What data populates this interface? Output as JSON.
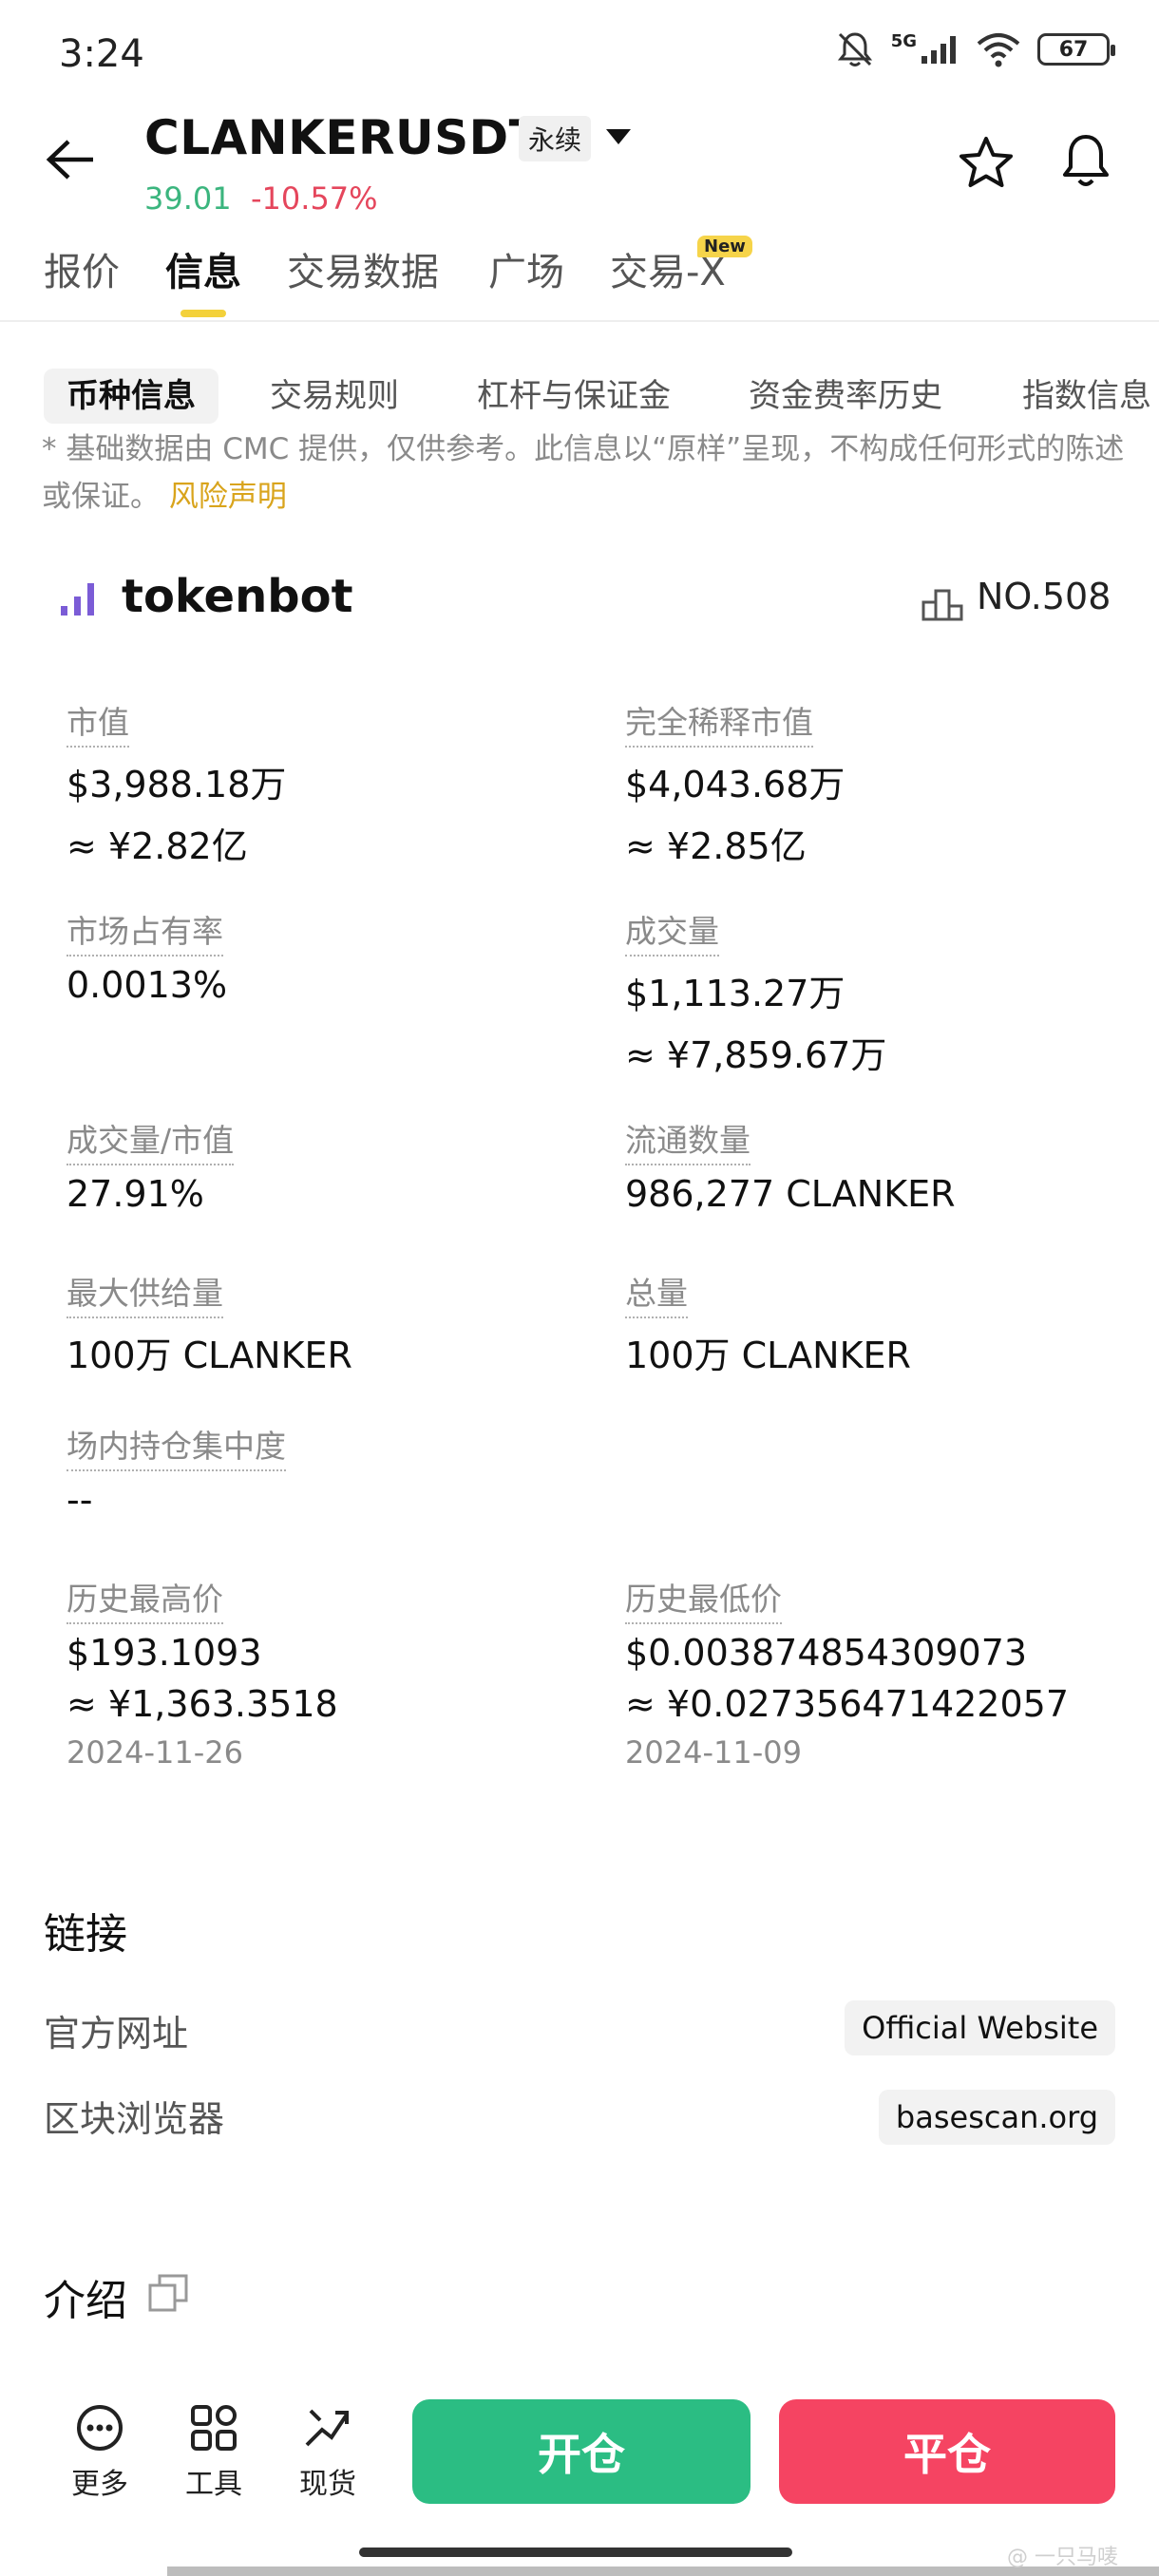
{
  "status": {
    "time": "3:24",
    "network": "5G",
    "battery": "67"
  },
  "header": {
    "symbol": "CLANKERUSDT",
    "contract_type": "永续",
    "price": "39.01",
    "change": "-10.57%"
  },
  "tabs": [
    {
      "label": "报价"
    },
    {
      "label": "信息"
    },
    {
      "label": "交易数据"
    },
    {
      "label": "广场"
    },
    {
      "label": "交易-X"
    }
  ],
  "new_badge": "New",
  "sub_tabs": [
    {
      "label": "币种信息"
    },
    {
      "label": "交易规则"
    },
    {
      "label": "杠杆与保证金"
    },
    {
      "label": "资金费率历史"
    },
    {
      "label": "指数信息"
    }
  ],
  "disclaimer": {
    "text": "* 基础数据由 CMC 提供，仅供参考。此信息以“原样”呈现，不构成任何形式的陈述或保证。",
    "risk_link": "风险声明"
  },
  "token": {
    "name": "tokenbot",
    "rank": "NO.508"
  },
  "stats": {
    "market_cap": {
      "label": "市值",
      "value": "$3,988.18万",
      "sub": "≈ ¥2.82亿"
    },
    "fdv": {
      "label": "完全稀释市值",
      "value": "$4,043.68万",
      "sub": "≈ ¥2.85亿"
    },
    "dominance": {
      "label": "市场占有率",
      "value": "0.0013%"
    },
    "volume": {
      "label": "成交量",
      "value": "$1,113.27万",
      "sub": "≈ ¥7,859.67万"
    },
    "vol_mcap": {
      "label": "成交量/市值",
      "value": "27.91%"
    },
    "circulating": {
      "label": "流通数量",
      "value": "986,277 CLANKER"
    },
    "max_supply": {
      "label": "最大供给量",
      "value": "100万 CLANKER"
    },
    "total_supply": {
      "label": "总量",
      "value": "100万 CLANKER"
    },
    "concentration": {
      "label": "场内持仓集中度",
      "value": "--"
    },
    "ath": {
      "label": "历史最高价",
      "value": "$193.1093",
      "sub": "≈ ¥1,363.3518",
      "date": "2024-11-26"
    },
    "atl": {
      "label": "历史最低价",
      "value": "$0.003874854309073",
      "sub": "≈ ¥0.027356471422057",
      "date": "2024-11-09"
    }
  },
  "links": {
    "title": "链接",
    "website_label": "官方网址",
    "website_value": "Official Website",
    "explorer_label": "区块浏览器",
    "explorer_value": "basescan.org"
  },
  "intro": {
    "title": "介绍"
  },
  "bottom_bar": {
    "more": "更多",
    "tools": "工具",
    "spot": "现货",
    "open": "开仓",
    "close": "平仓"
  },
  "watermark": "@ 一只马唛",
  "colors": {
    "up": "#2bbd83",
    "down": "#f54462",
    "accent": "#f3d13b",
    "risk": "#d9a41c"
  }
}
